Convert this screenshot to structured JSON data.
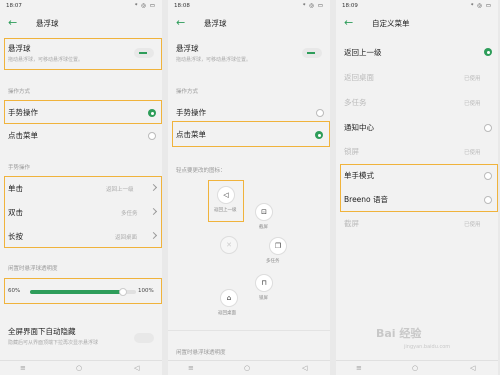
{
  "panel1": {
    "status": {
      "time": "18:07",
      "icons": "* ◎ ▭"
    },
    "title": "悬浮球",
    "float_ball": {
      "label": "悬浮球",
      "desc": "拖动悬浮球，可移动悬浮球位置。"
    },
    "op_section": "操作方式",
    "gesture": "手势操作",
    "tap_menu": "点击菜单",
    "gesture_section": "手势操作",
    "single_tap": {
      "label": "单击",
      "value": "返回上一级"
    },
    "double_tap": {
      "label": "双击",
      "value": "多任务"
    },
    "long_press": {
      "label": "长按",
      "value": "返回桌面"
    },
    "opacity_section": "闲置时悬浮球透明度",
    "opacity": {
      "min": "60%",
      "max": "100%",
      "level_percent": 88
    },
    "fullscreen_hide": {
      "label": "全屏界面下自动隐藏",
      "desc": "隐藏后可从界面顶端下拉再次显示悬浮球"
    }
  },
  "panel2": {
    "status": {
      "time": "18:08",
      "icons": "* ◎ ▭"
    },
    "title": "悬浮球",
    "float_ball": {
      "label": "悬浮球",
      "desc": "拖动悬浮球，可移动悬浮球位置。"
    },
    "op_section": "操作方式",
    "gesture": "手势操作",
    "tap_menu": "点击菜单",
    "icon_prompt": "轻点要更改的图标：",
    "icons": {
      "back": "返回上一级",
      "screenshot": "截屏",
      "multitask": "多任务",
      "lock": "锁屏",
      "home": "返回桌面"
    },
    "opacity_section": "闲置时悬浮球透明度"
  },
  "panel3": {
    "status": {
      "time": "18:09",
      "icons": "* ◎ ▭"
    },
    "title": "自定义菜单",
    "items": [
      {
        "label": "返回上一级",
        "state": "",
        "selected": true
      },
      {
        "label": "返回桌面",
        "state": "已使用",
        "selected": false
      },
      {
        "label": "多任务",
        "state": "已使用",
        "selected": false
      },
      {
        "label": "通知中心",
        "state": "",
        "selected": false
      },
      {
        "label": "锁屏",
        "state": "已使用",
        "selected": false
      },
      {
        "label": "单手模式",
        "state": "",
        "selected": false
      },
      {
        "label": "Breeno 语音",
        "state": "",
        "selected": false
      },
      {
        "label": "截屏",
        "state": "已使用",
        "selected": false
      }
    ],
    "watermark": "Bai 经验",
    "watermark_url": "jingyan.baidu.com"
  },
  "colors": {
    "accent": "#2e9d5a",
    "highlight": "#f0b33c"
  }
}
